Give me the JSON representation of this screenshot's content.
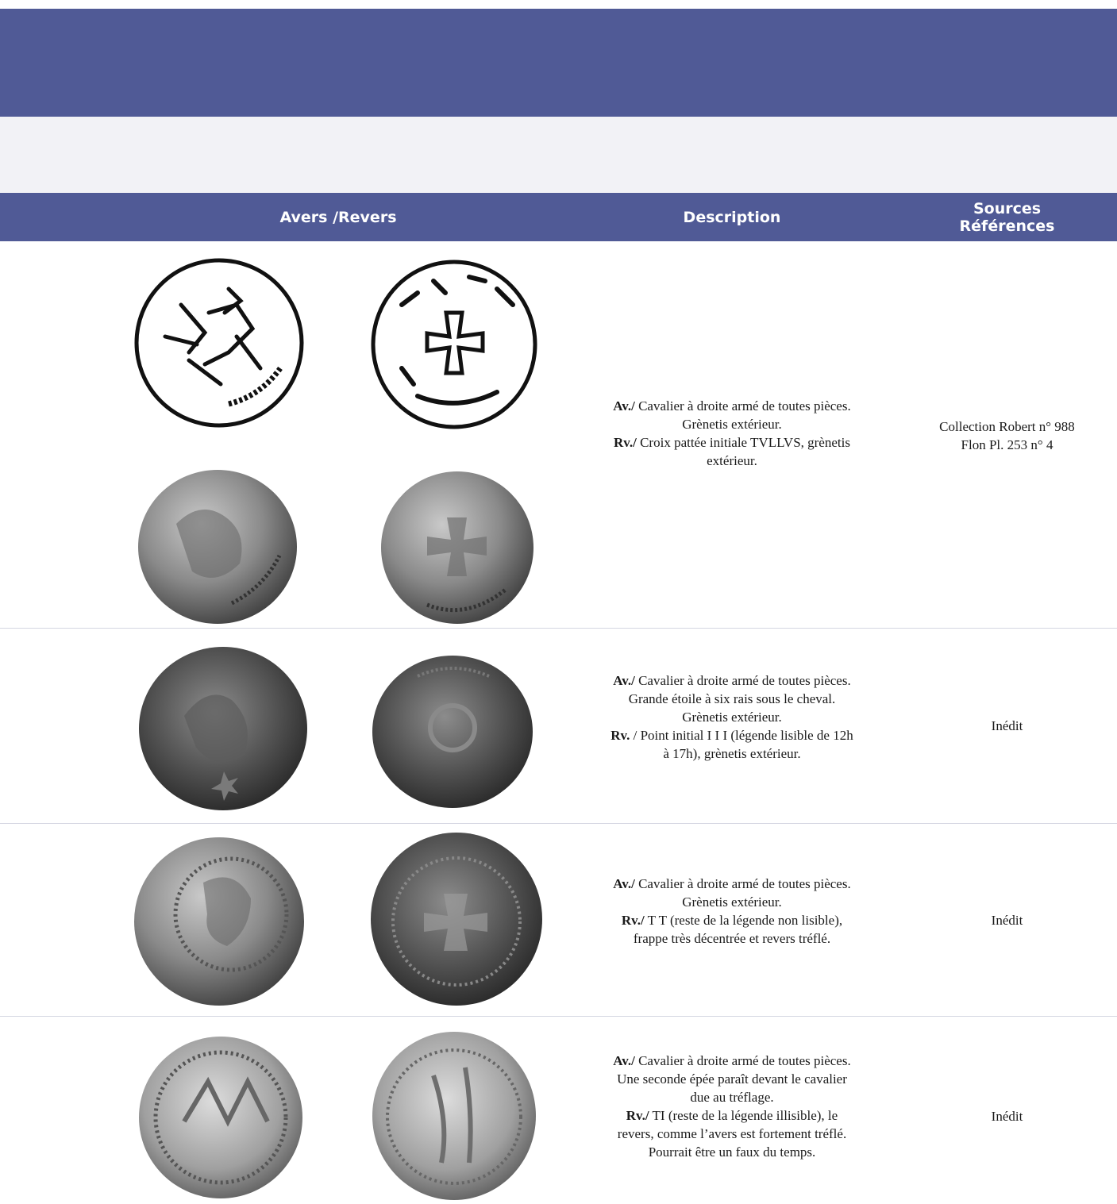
{
  "header": {
    "col_images": "Avers /Revers",
    "col_description": "Description",
    "col_sources_line1": "Sources",
    "col_sources_line2": "Références"
  },
  "rows": [
    {
      "av_label": "Av./",
      "av_lines": [
        "Cavalier à droite armé de toutes pièces.",
        "Grènetis extérieur."
      ],
      "rv_label": "Rv./",
      "rv_lines": [
        "Croix pattée initiale TVLLVS, grènetis",
        "extérieur."
      ],
      "sources": [
        "Collection Robert n° 988",
        "Flon Pl. 253 n° 4"
      ]
    },
    {
      "av_label": "Av./",
      "av_lines": [
        "Cavalier à droite armé de toutes pièces.",
        "Grande étoile à six rais sous le cheval.",
        "Grènetis extérieur."
      ],
      "rv_label": "Rv.",
      "rv_lines": [
        "/ Point initial I I I (légende lisible de 12h",
        "à 17h), grènetis extérieur."
      ],
      "sources": [
        "Inédit"
      ]
    },
    {
      "av_label": "Av./",
      "av_lines": [
        "Cavalier à droite armé de toutes pièces.",
        "Grènetis extérieur."
      ],
      "rv_label": "Rv./",
      "rv_lines": [
        "T T (reste de la légende non lisible),",
        "frappe très décentrée et revers tréflé."
      ],
      "sources": [
        "Inédit"
      ]
    },
    {
      "av_label": "Av./",
      "av_lines": [
        "Cavalier à droite armé de toutes pièces.",
        "Une seconde épée paraît devant le cavalier",
        "due au tréflage."
      ],
      "rv_label": "Rv./",
      "rv_lines": [
        "TI (reste de la légende illisible), le",
        "revers, comme l’avers est fortement tréflé.",
        "Pourrait être un faux du temps."
      ],
      "sources": [
        "Inédit"
      ]
    }
  ]
}
